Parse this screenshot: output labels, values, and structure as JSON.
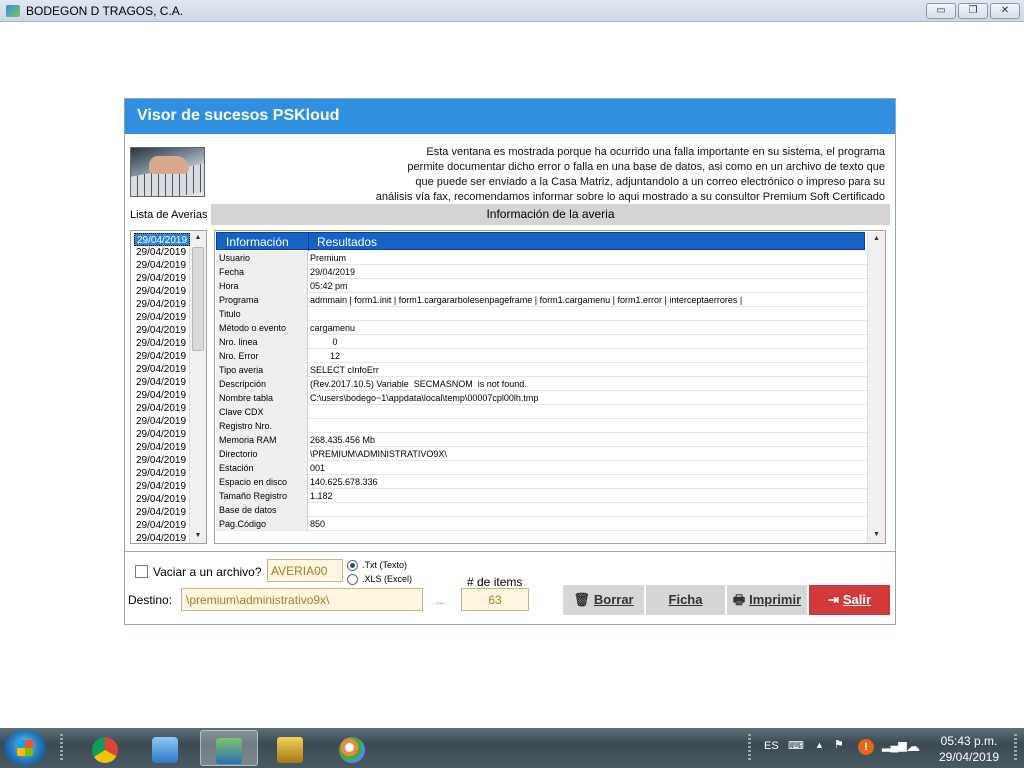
{
  "window": {
    "title": "BODEGON D TRAGOS, C.A.",
    "min_label": "▭",
    "max_label": "❐",
    "close_label": "✕"
  },
  "dialog": {
    "title": "Visor de sucesos PSKloud",
    "intro_lines": [
      "Esta ventana es mostrada porque ha ocurrido una falla importante en su sistema, el programa",
      "permite documentar dicho error o falla en una base de datos, asi como en un archivo de texto que",
      "que puede ser enviado a la Casa Matriz, adjuntandolo a un correo electrónico o impreso para su",
      "análisis vía fax, recomendamos informar sobre lo aqui mostrado a su consultor Premium Soft Certificado"
    ],
    "list_label": "Lista de Averias",
    "info_header": "Información de la averia",
    "dates": [
      "29/04/2019",
      "29/04/2019",
      "29/04/2019",
      "29/04/2019",
      "29/04/2019",
      "29/04/2019",
      "29/04/2019",
      "29/04/2019",
      "29/04/2019",
      "29/04/2019",
      "29/04/2019",
      "29/04/2019",
      "29/04/2019",
      "29/04/2019",
      "29/04/2019",
      "29/04/2019",
      "29/04/2019",
      "29/04/2019",
      "29/04/2019",
      "29/04/2019",
      "29/04/2019",
      "29/04/2019",
      "29/04/2019",
      "29/04/2019"
    ],
    "grid": {
      "col1": "Información",
      "col2": "Resultados",
      "rows": [
        {
          "k": "Usuario",
          "v": "Premium"
        },
        {
          "k": "Fecha",
          "v": "29/04/2019"
        },
        {
          "k": "Hora",
          "v": "05:42 pm"
        },
        {
          "k": "Programa",
          "v": "admmain | form1.init | form1.cargararbolesenpageframe | form1.cargamenu | form1.error | interceptaerrores |"
        },
        {
          "k": "Titulo",
          "v": ""
        },
        {
          "k": "Método o evento",
          "v": "cargamenu"
        },
        {
          "k": "Nro. linea",
          "v": "         0"
        },
        {
          "k": "Nro. Error",
          "v": "        12"
        },
        {
          "k": "Tipo averia",
          "v": "SELECT cInfoErr"
        },
        {
          "k": "Descripción",
          "v": "(Rev.2017.10.5) Variable  SECMASNOM  is not found."
        },
        {
          "k": "Nombre tabla",
          "v": "C:\\users\\bodego~1\\appdata\\local\\temp\\00007cpl00lh.tmp"
        },
        {
          "k": "Clave CDX",
          "v": ""
        },
        {
          "k": "Registro Nro.",
          "v": ""
        },
        {
          "k": "Memoria RAM",
          "v": "268.435.456 Mb"
        },
        {
          "k": "Directorio",
          "v": "\\PREMIUM\\ADMINISTRATIVO9X\\"
        },
        {
          "k": "Estación",
          "v": "001"
        },
        {
          "k": "Espacio en disco",
          "v": "140.625.678.336"
        },
        {
          "k": "Tamaño Registro",
          "v": "1.182"
        },
        {
          "k": "Base de datos",
          "v": ""
        },
        {
          "k": "Pag.Código",
          "v": "850"
        }
      ]
    },
    "vaciar_label": "Vaciar a un archivo?",
    "file_name": "AVERIA00",
    "radio_txt": ".Txt (Texto)",
    "radio_xls": ".XLS (Excel)",
    "destino_label": "Destino:",
    "destino_value": "\\premium\\administrativo9x\\",
    "ellipsis": "...",
    "items_label": "# de items",
    "items_value": "63",
    "buttons": {
      "borrar": "Borrar",
      "ficha": "Ficha",
      "imprimir": "Imprimir",
      "salir": "Salir"
    }
  },
  "taskbar": {
    "lang": "ES",
    "time": "05:43 p.m.",
    "date": "29/04/2019"
  }
}
